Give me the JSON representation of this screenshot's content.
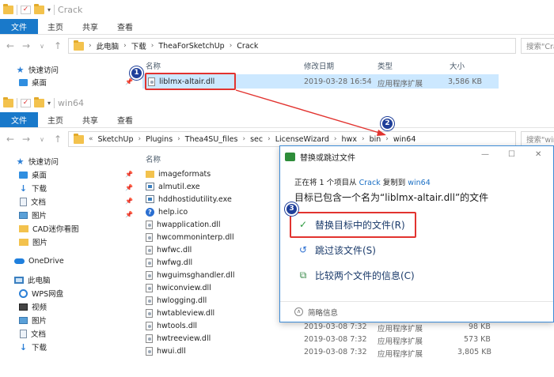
{
  "window1": {
    "title": "Crack",
    "ribbon": [
      "文件",
      "主页",
      "共享",
      "查看"
    ],
    "path": [
      "此电脑",
      "下载",
      "TheaForSketchUp",
      "Crack"
    ],
    "search_placeholder": "搜索\"Crack\"",
    "columns": {
      "name": "名称",
      "date": "修改日期",
      "type": "类型",
      "size": "大小"
    },
    "nav": [
      {
        "label": "快速访问",
        "icon": "star-icon"
      },
      {
        "label": "桌面",
        "icon": "desktop-icon"
      }
    ],
    "file": {
      "name": "liblmx-altair.dll",
      "date": "2019-03-28 16:54",
      "type": "应用程序扩展",
      "size": "3,586 KB"
    }
  },
  "window2": {
    "title": "win64",
    "ribbon": [
      "文件",
      "主页",
      "共享",
      "查看"
    ],
    "path_prefix": "«",
    "path": [
      "SketchUp",
      "Plugins",
      "Thea4SU_files",
      "sec",
      "LicenseWizard",
      "hwx",
      "bin",
      "win64"
    ],
    "search_placeholder": "搜索\"win64\"",
    "column_name": "名称",
    "nav": [
      {
        "label": "快速访问",
        "icon": "star-icon",
        "pinned": false
      },
      {
        "label": "桌面",
        "icon": "desktop-icon",
        "pinned": true
      },
      {
        "label": "下载",
        "icon": "download-icon",
        "pinned": true
      },
      {
        "label": "文档",
        "icon": "document-icon",
        "pinned": true
      },
      {
        "label": "图片",
        "icon": "picture-icon",
        "pinned": true
      },
      {
        "label": "CAD迷你看图",
        "icon": "folder-icon",
        "pinned": false
      },
      {
        "label": "图片",
        "icon": "folder-icon",
        "pinned": false
      },
      {
        "label": "OneDrive",
        "icon": "cloud-icon",
        "pinned": false
      },
      {
        "label": "此电脑",
        "icon": "computer-icon",
        "pinned": false
      },
      {
        "label": "WPS网盘",
        "icon": "wps-icon",
        "pinned": false
      },
      {
        "label": "视频",
        "icon": "video-icon",
        "pinned": false
      },
      {
        "label": "图片",
        "icon": "picture-icon",
        "pinned": false
      },
      {
        "label": "文档",
        "icon": "document-icon",
        "pinned": false
      },
      {
        "label": "下载",
        "icon": "download-icon",
        "pinned": false
      }
    ],
    "files": [
      {
        "name": "imageformats",
        "icon": "folder"
      },
      {
        "name": "almutil.exe",
        "icon": "exe"
      },
      {
        "name": "hddhostidutility.exe",
        "icon": "exe"
      },
      {
        "name": "help.ico",
        "icon": "ico"
      },
      {
        "name": "hwapplication.dll",
        "icon": "dll"
      },
      {
        "name": "hwcommoninterp.dll",
        "icon": "dll"
      },
      {
        "name": "hwfwc.dll",
        "icon": "dll"
      },
      {
        "name": "hwfwg.dll",
        "icon": "dll"
      },
      {
        "name": "hwguimsghandler.dll",
        "icon": "dll"
      },
      {
        "name": "hwiconview.dll",
        "icon": "dll"
      },
      {
        "name": "hwlogging.dll",
        "icon": "dll"
      },
      {
        "name": "hwtableview.dll",
        "icon": "dll"
      },
      {
        "name": "hwtools.dll",
        "icon": "dll",
        "date": "2019-03-08 7:32",
        "type": "应用程序扩展",
        "size": "98 KB"
      },
      {
        "name": "hwtreeview.dll",
        "icon": "dll",
        "date": "2019-03-08 7:32",
        "type": "应用程序扩展",
        "size": "573 KB"
      },
      {
        "name": "hwui.dll",
        "icon": "dll",
        "date": "2019-03-08 7:32",
        "type": "应用程序扩展",
        "size": "3,805 KB"
      }
    ]
  },
  "dialog": {
    "title": "替换或跳过文件",
    "line1_a": "正在将 1 个项目从 ",
    "line1_src": "Crack",
    "line1_b": " 复制到 ",
    "line1_dst": "win64",
    "line2": "目标已包含一个名为“liblmx-altair.dll”的文件",
    "option_replace": "替换目标中的文件(R)",
    "option_skip": "跳过该文件(S)",
    "option_compare": "比较两个文件的信息(C)",
    "details": "简略信息"
  },
  "badges": [
    "1",
    "2",
    "3"
  ],
  "colors": {
    "accent": "#1979ca",
    "annotation": "#e2332f",
    "badge": "#1f3f9a",
    "selection": "#cce8ff"
  }
}
